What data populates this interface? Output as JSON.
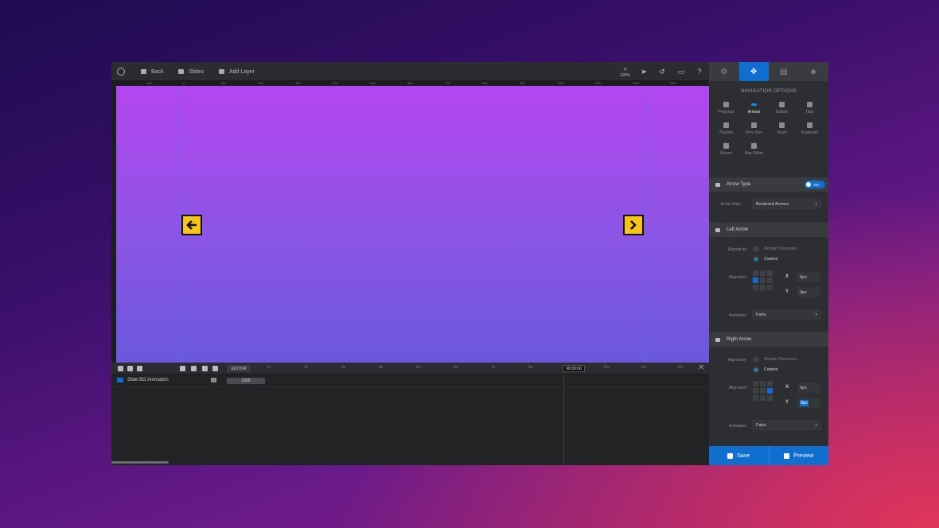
{
  "topbar": {
    "back_label": "Back",
    "slides_label": "Slides",
    "add_layer_label": "Add Layer",
    "zoom": "100%"
  },
  "canvas": {
    "ruler_ticks": [
      "-100",
      "0",
      "100",
      "200",
      "300",
      "400",
      "500",
      "600",
      "700",
      "800",
      "900",
      "1000",
      "1100",
      "1200",
      "1300"
    ]
  },
  "panel": {
    "title": "NAVIGATION OPTIONS",
    "nav_items": [
      {
        "label": "Progress",
        "icon": "progress-icon"
      },
      {
        "label": "Arrows",
        "icon": "arrows-icon",
        "active": true
      },
      {
        "label": "Bullets",
        "icon": "bullets-icon"
      },
      {
        "label": "Tabs",
        "icon": "tabs-icon"
      },
      {
        "label": "Thumbs",
        "icon": "thumbs-icon"
      },
      {
        "label": "Prev Size",
        "icon": "prev-size-icon"
      },
      {
        "label": "Touch",
        "icon": "touch-icon"
      },
      {
        "label": "Keyboard",
        "icon": "keyboard-icon"
      },
      {
        "label": "Mouse",
        "icon": "mouse-icon"
      },
      {
        "label": "Nav Editor",
        "icon": "nav-editor-icon"
      }
    ],
    "arrow_type": {
      "label": "Arrow Type",
      "toggle": "ON"
    },
    "arrow_style": {
      "label": "Arrow Style",
      "value": "Bordered Arrows"
    },
    "left_arrow": {
      "title": "Left Arrow",
      "aligned_by_label": "Aligned by",
      "option_module": "Module Dimension",
      "option_content": "Content",
      "alignment_label": "Alignment",
      "x_label": "X",
      "y_label": "Y",
      "x_value": "0px",
      "y_value": "0px",
      "animation_label": "Animation",
      "animation_value": "Fade"
    },
    "right_arrow": {
      "title": "Right Arrow",
      "aligned_by_label": "Aligned by",
      "option_module": "Module Dimension",
      "option_content": "Content",
      "alignment_label": "Alignment",
      "x_label": "X",
      "y_label": "Y",
      "x_value": "0px",
      "y_value": "0px",
      "animation_label": "Animation",
      "animation_value": "Fade"
    },
    "save_label": "Save",
    "preview_label": "Preview"
  },
  "timeline": {
    "editor_label": "EDITOR",
    "ticks": [
      "1s",
      "2s",
      "3s",
      "4s",
      "5s",
      "6s",
      "7s",
      "8s",
      "10s",
      "11s",
      "12s"
    ],
    "current_time": "00:09:00",
    "layer_name": "Slide BG Animation",
    "duration": "1000"
  },
  "colors": {
    "accent": "#0f6fd1",
    "arrow_fill": "#f5c518",
    "stage_top": "#b346f0",
    "stage_bottom": "#6a58dc"
  }
}
